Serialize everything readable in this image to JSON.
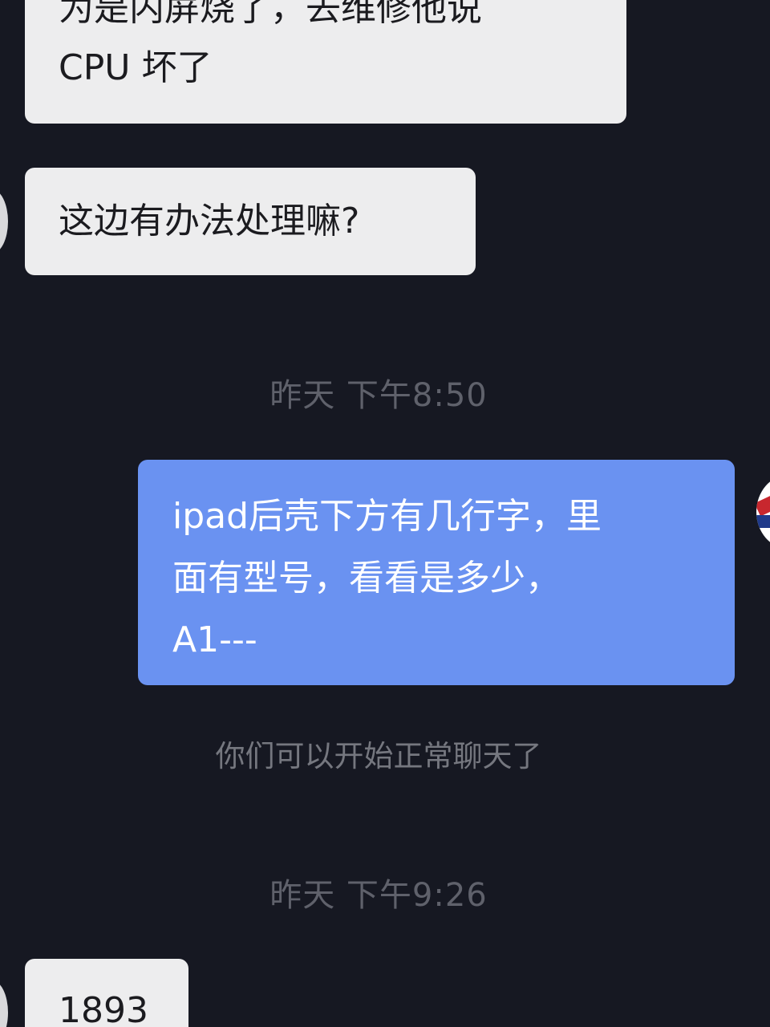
{
  "messages": [
    {
      "side": "incoming",
      "text": "为是内屏烧了，去维修他说\nCPU 坏了"
    },
    {
      "side": "incoming",
      "text": "这边有办法处理嘛?"
    },
    {
      "side": "outgoing",
      "text": "ipad后壳下方有几行字，里\n面有型号，看看是多少，\nA1---"
    },
    {
      "side": "incoming",
      "text": "1893"
    }
  ],
  "timestamps": [
    "昨天 下午8:50",
    "昨天 下午9:26"
  ],
  "system_notice": "你们可以开始正常聊天了",
  "colors": {
    "background": "#161822",
    "incoming_bubble": "#ededee",
    "outgoing_bubble": "#6a92f1",
    "timestamp_text": "#5f616b"
  }
}
